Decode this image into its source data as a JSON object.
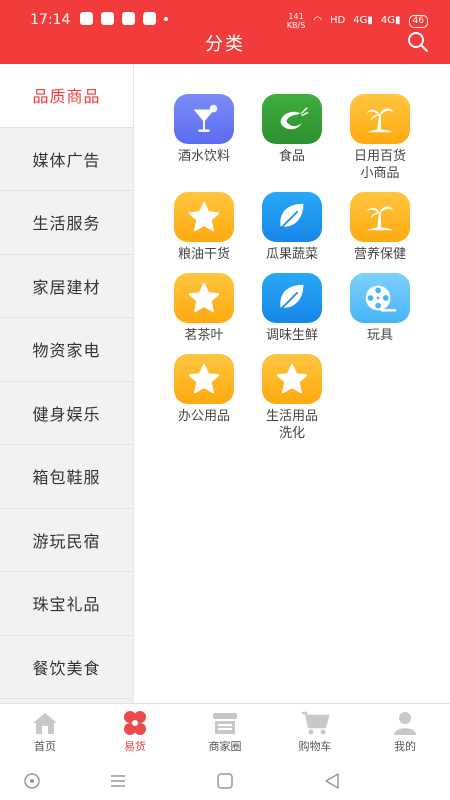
{
  "status_bar": {
    "time": "17:14",
    "net_speed": "141\nKB/S",
    "hd": "HD",
    "signal_1": "4G",
    "signal_2": "4G",
    "battery": "46"
  },
  "header": {
    "title": "分类",
    "search_icon": "search-icon",
    "color": "#f23b3b"
  },
  "sidebar": {
    "active_index": 0,
    "items": [
      {
        "label": "品质商品"
      },
      {
        "label": "媒体广告"
      },
      {
        "label": "生活服务"
      },
      {
        "label": "家居建材"
      },
      {
        "label": "物资家电"
      },
      {
        "label": "健身娱乐"
      },
      {
        "label": "箱包鞋服"
      },
      {
        "label": "游玩民宿"
      },
      {
        "label": "珠宝礼品"
      },
      {
        "label": "餐饮美食"
      }
    ]
  },
  "categories": [
    {
      "label": "酒水饮料",
      "icon": "cocktail-icon"
    },
    {
      "label": "食品",
      "icon": "shrimp-icon"
    },
    {
      "label": "日用百货\n小商品",
      "icon": "palm-tree-icon"
    },
    {
      "label": "粮油干货",
      "icon": "star-icon"
    },
    {
      "label": "瓜果蔬菜",
      "icon": "leaf-icon"
    },
    {
      "label": "营养保健",
      "icon": "palm-tree-icon"
    },
    {
      "label": "茗茶叶",
      "icon": "star-icon"
    },
    {
      "label": "调味生鲜",
      "icon": "leaf-icon"
    },
    {
      "label": "玩具",
      "icon": "film-reel-icon"
    },
    {
      "label": "办公用品",
      "icon": "star-icon"
    },
    {
      "label": "生活用品\n洗化",
      "icon": "star-icon"
    }
  ],
  "tabbar": {
    "active_index": 1,
    "items": [
      {
        "label": "首页",
        "icon": "home-icon"
      },
      {
        "label": "易货",
        "icon": "flower-icon"
      },
      {
        "label": "商家圈",
        "icon": "shop-icon"
      },
      {
        "label": "购物车",
        "icon": "cart-icon"
      },
      {
        "label": "我的",
        "icon": "user-icon"
      }
    ]
  },
  "colors": {
    "accent": "#f23b3b",
    "tab_active": "#e94040",
    "sidebar_bg": "#f2f2f2"
  }
}
